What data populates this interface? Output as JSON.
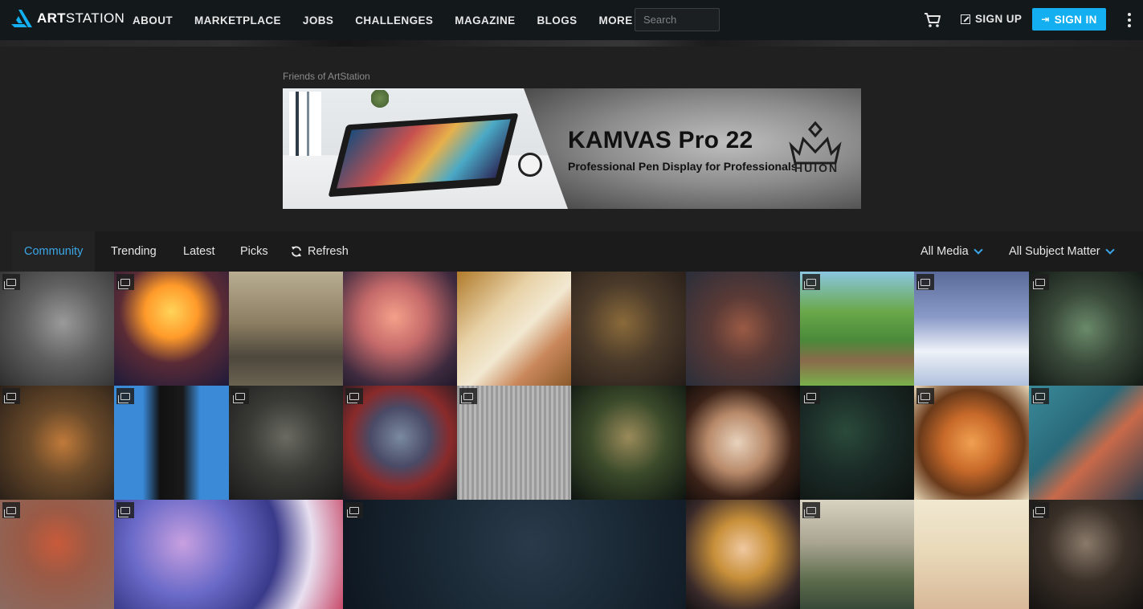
{
  "header": {
    "logo_text_bold": "ART",
    "logo_text_light": "STATION",
    "nav": [
      "ABOUT",
      "MARKETPLACE",
      "JOBS",
      "CHALLENGES",
      "MAGAZINE",
      "BLOGS",
      "MORE"
    ],
    "search_placeholder": "Search",
    "signup_label": "SIGN UP",
    "signin_label": "SIGN IN"
  },
  "sponsor": {
    "label": "Friends of ArtStation",
    "title": "KAMVAS Pro 22",
    "subtitle": "Professional Pen Display for Professionals",
    "brand": "HUION"
  },
  "filters": {
    "tabs": [
      "Community",
      "Trending",
      "Latest",
      "Picks"
    ],
    "active_tab": "Community",
    "refresh_label": "Refresh",
    "media_label": "All Media",
    "subject_label": "All Subject Matter"
  },
  "colors": {
    "accent": "#13aff0",
    "link_active": "#3ba6e8",
    "nav_bg": "#13181b",
    "page_bg": "#202020"
  },
  "gallery": {
    "row1": [
      "bearded-dwarf-sculpt",
      "flame-hair-heroine",
      "soldiers-and-tank",
      "pink-haired-girl",
      "robot-girl-illustration",
      "warrior-with-sword",
      "spaceship-render",
      "forest-house-landscape",
      "jetpack-soldier-sky",
      "elf-ranger-lantern"
    ],
    "row2": [
      "bearded-king-cartoon",
      "black-robed-figure-blue",
      "dark-fantasy-city",
      "armored-superhero",
      "woman-pose-sketch",
      "fighter-with-light",
      "woman-with-white-headscarf",
      "green-lit-building",
      "pumpkin-jack-o-lantern",
      "comic-duo-teal"
    ],
    "row3": [
      "red-creature-sculpt",
      "fox-and-hero-game-art",
      "dark-hair-closeup",
      "golden-haired-woman-portrait",
      "sci-fi-street-soldier",
      "art-nouveau-figure",
      "king-arthur-poster"
    ]
  }
}
